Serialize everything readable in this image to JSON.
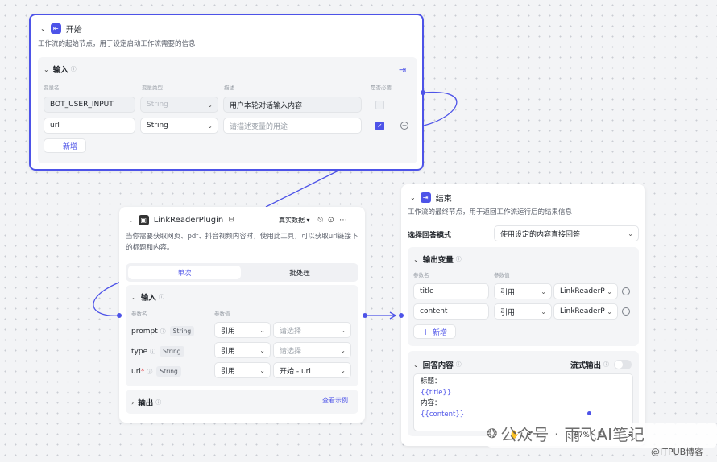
{
  "start_node": {
    "title": "开始",
    "description": "工作流的起始节点，用于设定启动工作流需要的信息",
    "input_section": "输入",
    "columns": [
      "变量名",
      "变量类型",
      "描述",
      "是否必要"
    ],
    "rows": [
      {
        "name": "BOT_USER_INPUT",
        "type": "String",
        "description": "用户本轮对话输入内容",
        "required": false
      },
      {
        "name": "url",
        "type": "String",
        "description_placeholder": "请描述变量的用途",
        "required": true
      }
    ],
    "add_label": "新增"
  },
  "plugin_node": {
    "title": "LinkReaderPlugin",
    "mode": "真实数据",
    "description": "当你需要获取网页、pdf、抖音视频内容时，使用此工具，可以获取url链接下的标题和内容。",
    "tabs": [
      "单次",
      "批处理"
    ],
    "input_section": "输入",
    "columns": [
      "参数名",
      "参数值"
    ],
    "params": [
      {
        "name": "prompt",
        "type": "String",
        "source": "引用",
        "value": "请选择",
        "required": false
      },
      {
        "name": "type",
        "type": "String",
        "source": "引用",
        "value": "请选择",
        "required": false
      },
      {
        "name": "url",
        "type": "String",
        "source": "引用",
        "value": "开始 - url",
        "required": true
      }
    ],
    "output_section": "输出",
    "view_example": "查看示例"
  },
  "end_node": {
    "title": "结束",
    "description": "工作流的最终节点，用于返回工作流运行后的结果信息",
    "answer_mode_label": "选择回答模式",
    "answer_mode_value": "使用设定的内容直接回答",
    "output_section": "输出变量",
    "columns": [
      "参数名",
      "参数值"
    ],
    "outputs": [
      {
        "name": "title",
        "source": "引用",
        "value": "LinkReaderP"
      },
      {
        "name": "content",
        "source": "引用",
        "value": "LinkReaderP"
      }
    ],
    "add_label": "新增",
    "answer_section": "回答内容",
    "stream_label": "流式输出",
    "stream_on": false,
    "answer_lines": [
      "标题：",
      "{{title}}",
      "内容：",
      "{{content}}"
    ]
  },
  "toolbar": {
    "zoom": "87%"
  },
  "watermark": {
    "text": "公众号 · 雨飞AI笔记",
    "source": "@ITPUB博客"
  },
  "colors": {
    "accent": "#4d53e8"
  }
}
